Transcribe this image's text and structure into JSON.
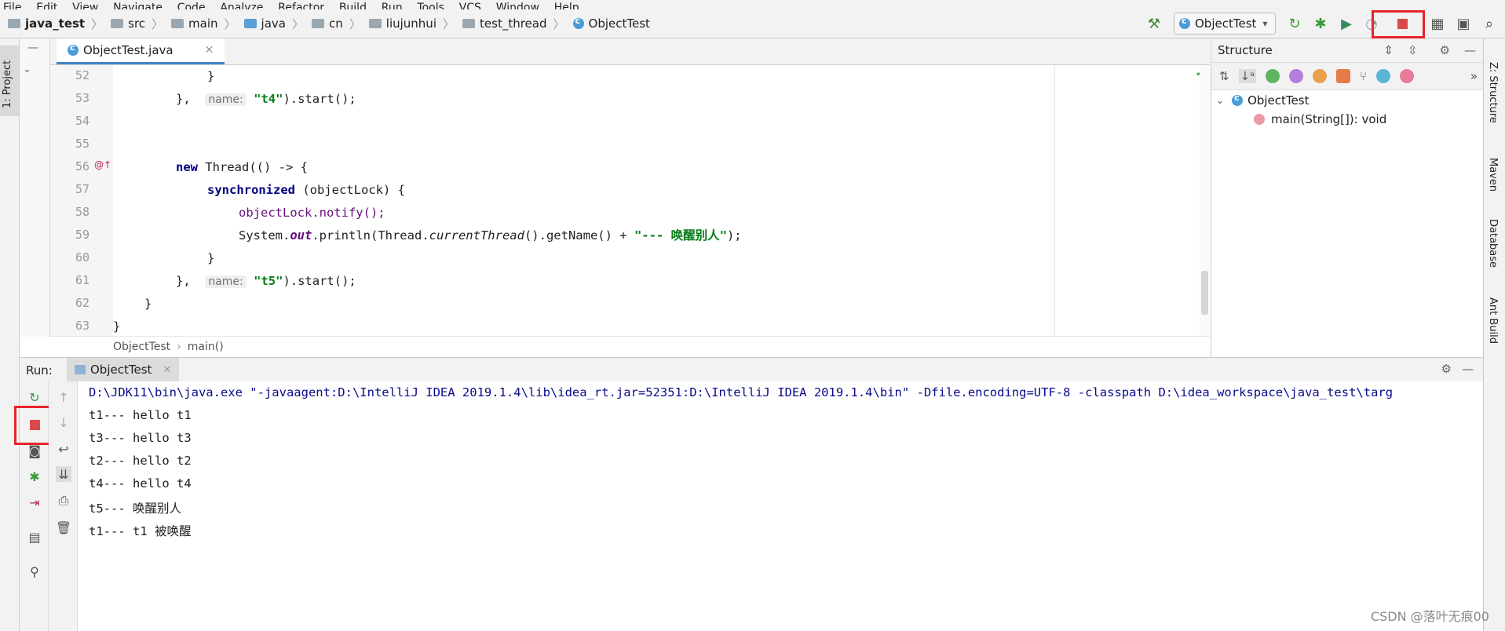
{
  "menu": [
    "File",
    "Edit",
    "View",
    "Navigate",
    "Code",
    "Analyze",
    "Refactor",
    "Build",
    "Run",
    "Tools",
    "VCS",
    "Window",
    "Help"
  ],
  "breadcrumb": [
    "java_test",
    "src",
    "main",
    "java",
    "cn",
    "liujunhui",
    "test_thread",
    "ObjectTest"
  ],
  "toolbar": {
    "run_config": "ObjectTest",
    "icons": [
      "hammer-icon",
      "rerun-icon",
      "debug-icon",
      "coverage-icon",
      "profile-icon",
      "stop-icon",
      "project-structure-icon",
      "terminal-icon",
      "search-icon"
    ]
  },
  "left_tab": "1: Project",
  "editor": {
    "tab_label": "ObjectTest.java",
    "line_numbers": [
      "52",
      "53",
      "54",
      "55",
      "56",
      "57",
      "58",
      "59",
      "60",
      "61",
      "62",
      "63"
    ],
    "hint_name": "name:",
    "t4": "\"t4\"",
    "t5": "\"t5\"",
    "start": ").start();",
    "kw_new": "new",
    "thread_lambda": " Thread(() -> {",
    "kw_sync": "synchronized",
    "sync_arg": " (objectLock) {",
    "notify": "objectLock.notify();",
    "sys": "System.",
    "out": "out",
    "println": ".println(Thread.",
    "current": "currentThread",
    "getname": "().getName() + ",
    "wake_str": "\"--- 唤醒别人\"",
    "close_paren": ");",
    "brace_open": "}",
    "comma": "},",
    "footer_crumbs": [
      "ObjectTest",
      "main()"
    ]
  },
  "structure": {
    "title": "Structure",
    "root": "ObjectTest",
    "child": "main(String[]): void"
  },
  "right_tabs": [
    "Z: Structure",
    "Maven",
    "Database",
    "Ant Build"
  ],
  "run": {
    "label": "Run:",
    "tab": "ObjectTest",
    "console": [
      "D:\\JDK11\\bin\\java.exe \"-javaagent:D:\\IntelliJ IDEA 2019.1.4\\lib\\idea_rt.jar=52351:D:\\IntelliJ IDEA 2019.1.4\\bin\" -Dfile.encoding=UTF-8 -classpath D:\\idea_workspace\\java_test\\targ",
      "t1--- hello t1",
      "t3--- hello t3",
      "t2--- hello t2",
      "t4--- hello t4",
      "t5--- 唤醒别人",
      "t1--- t1 被唤醒"
    ]
  },
  "watermark": "CSDN @落叶无痕00",
  "colors": {
    "highlight": "#e8242b",
    "accent": "#4083c9",
    "keyword": "#000080",
    "string": "#067d17"
  }
}
